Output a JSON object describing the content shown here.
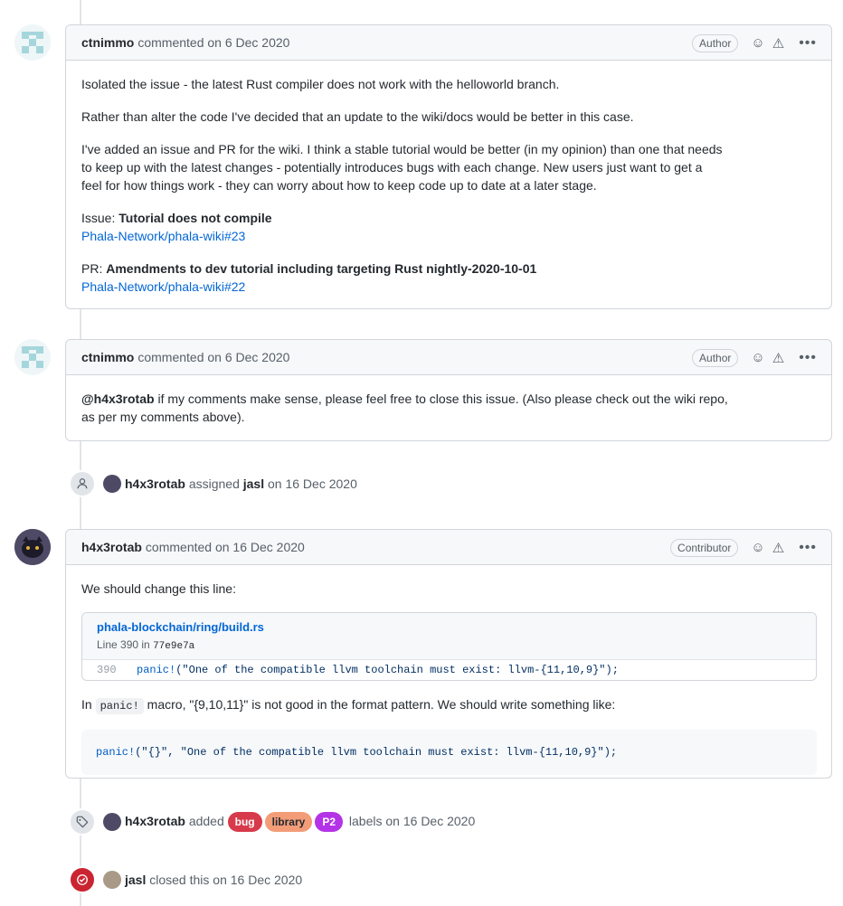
{
  "comments": [
    {
      "author": "ctnimmo",
      "meta": "commented on 6 Dec 2020",
      "role": "Author",
      "body": {
        "p1": "Isolated the issue - the latest Rust compiler does not work with the helloworld branch.",
        "p2": "Rather than alter the code I've decided that an update to the wiki/docs would be better in this case.",
        "p3_line1": "I've added an issue and PR for the wiki. I think a stable tutorial would be better (in my opinion) than one that needs",
        "p3_line2": "to keep up with the latest changes - potentially introduces bugs with each change. New users just want to get a",
        "p3_line3": "feel for how things work - they can worry about how to keep code up to date at a later stage.",
        "issue_prefix": "Issue:",
        "issue_title": "Tutorial does not compile",
        "issue_link": "Phala-Network/phala-wiki#23",
        "pr_prefix": "PR:",
        "pr_title": "Amendments to dev tutorial including targeting Rust nightly-2020-10-01",
        "pr_link": "Phala-Network/phala-wiki#22"
      }
    },
    {
      "author": "ctnimmo",
      "meta": "commented on 6 Dec 2020",
      "role": "Author",
      "body": {
        "mention": "@h4x3rotab",
        "text_line1": " if my comments make sense, please feel free to close this issue. (Also please check out the wiki repo,",
        "text_line2": "as per my comments above)."
      }
    },
    {
      "author": "h4x3rotab",
      "meta": "commented on 16 Dec 2020",
      "role": "Contributor",
      "body": {
        "intro": "We should change this line:",
        "embed_path": "phala-blockchain/ring/build.rs",
        "embed_line_info": "Line 390 in",
        "embed_sha": "77e9e7a",
        "embed_lineno": "390",
        "embed_kw": "panic!",
        "embed_code": "(\"One of the compatible llvm toolchain must exist: llvm-{11,10,9}\");",
        "after_in": "In",
        "after_code": "panic!",
        "after_text": " macro, \"{9,10,11}\" is not good in the format pattern. We should write something like:",
        "block_kw": "panic!",
        "block_code": "(\"{}\", \"One of the compatible llvm toolchain must exist: llvm-{11,10,9}\");"
      }
    }
  ],
  "events": {
    "assigned": {
      "icon": "person-icon",
      "actor": "h4x3rotab",
      "verb": "assigned",
      "target": "jasl",
      "when": "on 16 Dec 2020"
    },
    "labeled": {
      "icon": "tag-icon",
      "actor": "h4x3rotab",
      "verb": "added",
      "labels": [
        {
          "name": "bug",
          "bg": "#d73a4a",
          "fg": "#ffffff"
        },
        {
          "name": "library",
          "bg": "#f29c78",
          "fg": "#24292e"
        },
        {
          "name": "P2",
          "bg": "#b433e6",
          "fg": "#ffffff"
        }
      ],
      "suffix": "labels",
      "when": "on 16 Dec 2020"
    },
    "closed": {
      "icon": "issue-closed-icon",
      "actor": "jasl",
      "verb": "closed this",
      "when": "on 16 Dec 2020"
    }
  },
  "icons": {
    "reaction": "smiley-icon",
    "hide": "triangle-icon",
    "more": "kebab-horizontal-icon"
  }
}
